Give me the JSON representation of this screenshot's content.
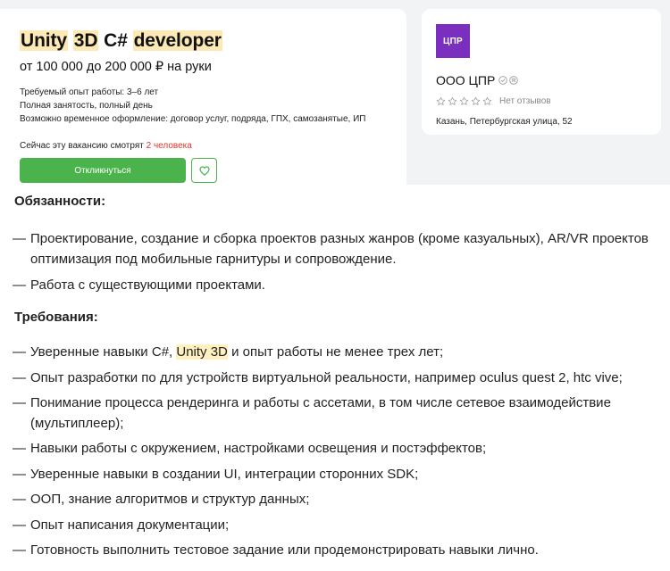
{
  "vacancy": {
    "title_parts": [
      "Unity",
      "3D",
      "C#",
      "developer"
    ],
    "salary": "от 100 000 до 200 000 ₽ на руки",
    "experience": "Требуемый опыт работы: 3–6 лет",
    "employment": "Полная занятость, полный день",
    "contract": "Возможно временное оформление: договор услуг, подряда, ГПХ, самозанятые, ИП",
    "watching_prefix": "Сейчас эту вакансию смотрят ",
    "watching_count": "2 человека",
    "apply_label": "Откликнуться",
    "favorite_icon": "heart-icon"
  },
  "company": {
    "logo_text": "ЦПР",
    "name": "ООО ЦПР",
    "badges": [
      "check-circle-icon",
      "registered-icon"
    ],
    "rating_stars": 0,
    "rating_max": 5,
    "no_reviews": "Нет отзывов",
    "address": "Казань, Петербургская улица, 52"
  },
  "description": {
    "duties_title": "Обязанности:",
    "duties": [
      "Проектирование, создание и сборка проектов разных жанров (кроме казуальных), AR/VR проектов оптимизация под мобильные гарнитуры и сопровождение.",
      "Работа с существующими проектами."
    ],
    "requirements_title": "Требования:",
    "requirements": [
      "Уверенные навыки C#, Unity 3D и опыт работы не менее трех лет;",
      "Опыт разработки по для устройств виртуальной реальности, например oculus quest 2, htc vive;",
      "Понимание процесса рендеринга и работы с ассетами, в том числе сетевое взаимодействие (мультиплеер);",
      "Навыки работы с окружением, настройками освещения и постэффектов;",
      "Уверенные навыки в создании UI, интеграции сторонних SDK;",
      "ООП, знание алгоритмов и структур данных;",
      "Опыт написания документации;",
      "Готовность выполнить тестовое задание или продемонстрировать навыки лично."
    ],
    "highlight_term": "Unity 3D"
  },
  "colors": {
    "accent_green": "#4bb34b",
    "highlight": "#fde9b5",
    "logo_purple": "#7b2fbf",
    "counter_red": "#e0372c"
  }
}
